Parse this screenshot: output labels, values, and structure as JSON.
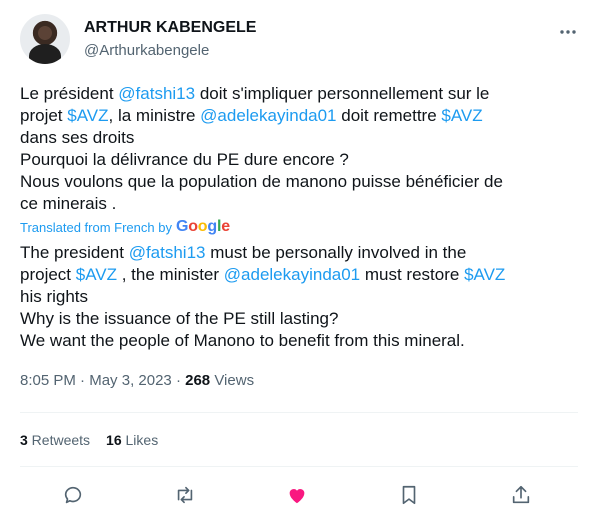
{
  "author": {
    "name": "ARTHUR KABENGELE",
    "handle": "@Arthurkabengele"
  },
  "tweet_original": {
    "line1_a": "Le président ",
    "mention1": "@fatshi13",
    "line1_b": " doit s'impliquer personnellement sur le",
    "line2_a": "projet ",
    "cashtag1": "$AVZ",
    "line2_b": ",  la ministre ",
    "mention2": "@adelekayinda01",
    "line2_c": " doit remettre ",
    "cashtag2": "$AVZ",
    "line3": "dans ses droits",
    "line4": "Pourquoi la délivrance du PE dure encore ?",
    "line5": "Nous voulons que la population de manono puisse bénéficier de",
    "line6": "ce minerais ."
  },
  "translation": {
    "label": "Translated from French by",
    "provider": "Google"
  },
  "tweet_translated": {
    "line1_a": "The president ",
    "mention1": "@fatshi13",
    "line1_b": " must be personally involved in the",
    "line2_a": "project ",
    "cashtag1": "$AVZ",
    "line2_b": " , the minister ",
    "mention2": "@adelekayinda01",
    "line2_c": " must restore ",
    "cashtag2": "$AVZ",
    "line3": "his rights",
    "line4": "Why is the issuance of the PE still lasting?",
    "line5": "We want the people of Manono to benefit from this mineral."
  },
  "meta": {
    "time": "8:05 PM",
    "sep1": " · ",
    "date": "May 3, 2023",
    "sep2": " · ",
    "views_count": "268",
    "views_label": " Views"
  },
  "stats": {
    "retweets_count": "3",
    "retweets_label": " Retweets",
    "likes_count": "16",
    "likes_label": " Likes"
  },
  "colors": {
    "link": "#1d9bf0",
    "like_active": "#f91880",
    "secondary": "#536471"
  },
  "icons": [
    "more-icon",
    "reply-icon",
    "retweet-icon",
    "like-icon",
    "bookmark-icon",
    "share-icon"
  ]
}
